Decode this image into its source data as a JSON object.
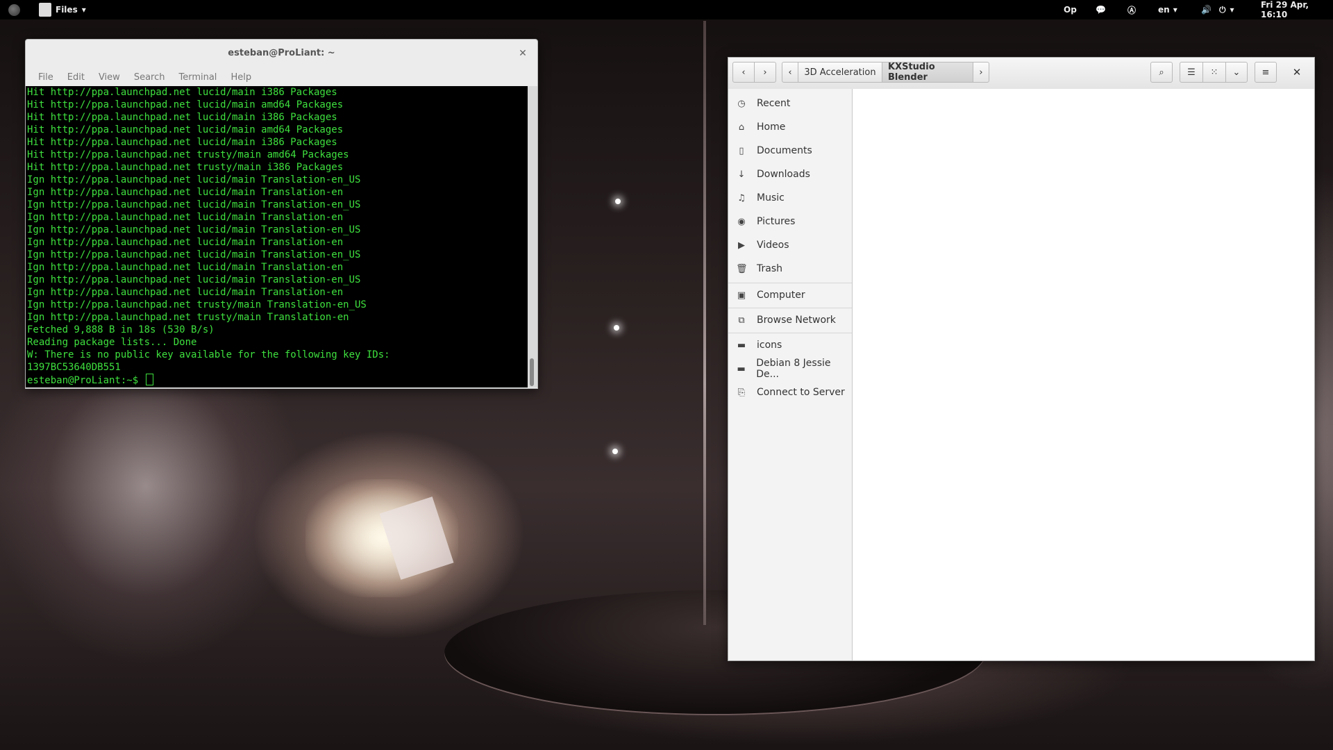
{
  "topbar": {
    "app_name": "Files",
    "indicator_op": "Op",
    "language": "en",
    "clock": "Fri 29 Apr, 16:10"
  },
  "terminal": {
    "title": "esteban@ProLiant: ~",
    "menu": [
      "File",
      "Edit",
      "View",
      "Search",
      "Terminal",
      "Help"
    ],
    "lines": [
      "Hit http://ppa.launchpad.net lucid/main i386 Packages",
      "Hit http://ppa.launchpad.net lucid/main amd64 Packages",
      "Hit http://ppa.launchpad.net lucid/main i386 Packages",
      "Hit http://ppa.launchpad.net lucid/main amd64 Packages",
      "Hit http://ppa.launchpad.net lucid/main i386 Packages",
      "Hit http://ppa.launchpad.net trusty/main amd64 Packages",
      "Hit http://ppa.launchpad.net trusty/main i386 Packages",
      "Ign http://ppa.launchpad.net lucid/main Translation-en_US",
      "Ign http://ppa.launchpad.net lucid/main Translation-en",
      "Ign http://ppa.launchpad.net lucid/main Translation-en_US",
      "Ign http://ppa.launchpad.net lucid/main Translation-en",
      "Ign http://ppa.launchpad.net lucid/main Translation-en_US",
      "Ign http://ppa.launchpad.net lucid/main Translation-en",
      "Ign http://ppa.launchpad.net lucid/main Translation-en_US",
      "Ign http://ppa.launchpad.net lucid/main Translation-en",
      "Ign http://ppa.launchpad.net lucid/main Translation-en_US",
      "Ign http://ppa.launchpad.net lucid/main Translation-en",
      "Ign http://ppa.launchpad.net trusty/main Translation-en_US",
      "Ign http://ppa.launchpad.net trusty/main Translation-en",
      "Fetched 9,888 B in 18s (530 B/s)",
      "Reading package lists... Done",
      "W: There is no public key available for the following key IDs:",
      "1397BC53640DB551"
    ],
    "prompt": "esteban@ProLiant:~$ "
  },
  "files": {
    "breadcrumbs": [
      "3D Acceleration",
      "KXStudio Blender"
    ],
    "sidebar": [
      {
        "label": "Recent",
        "icon": "clock-icon"
      },
      {
        "label": "Home",
        "icon": "home-icon"
      },
      {
        "label": "Documents",
        "icon": "document-icon"
      },
      {
        "label": "Downloads",
        "icon": "download-icon"
      },
      {
        "label": "Music",
        "icon": "music-icon"
      },
      {
        "label": "Pictures",
        "icon": "camera-icon"
      },
      {
        "label": "Videos",
        "icon": "video-icon"
      },
      {
        "label": "Trash",
        "icon": "trash-icon"
      },
      {
        "label": "Computer",
        "icon": "computer-icon"
      },
      {
        "label": "Browse Network",
        "icon": "network-icon"
      },
      {
        "label": "icons",
        "icon": "folder-icon"
      },
      {
        "label": "Debian 8 Jessie De...",
        "icon": "folder-icon"
      },
      {
        "label": "Connect to Server",
        "icon": "server-icon"
      }
    ]
  }
}
